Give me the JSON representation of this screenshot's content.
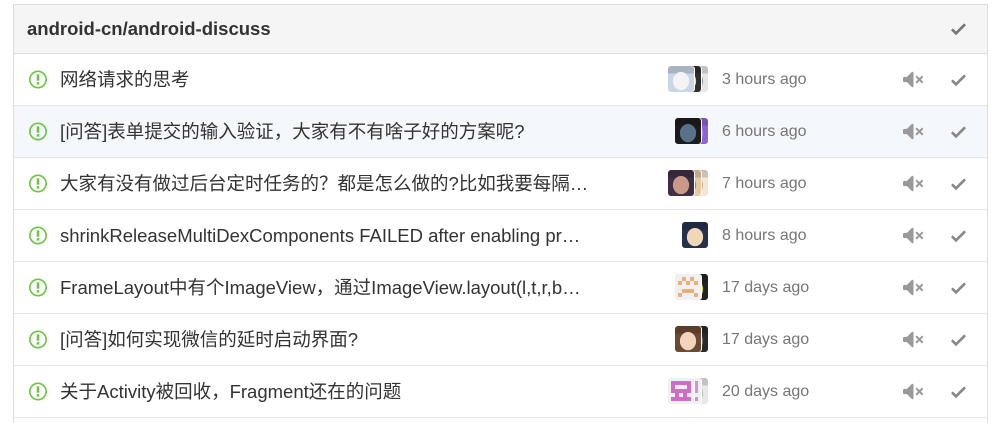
{
  "repo": {
    "name": "android-cn/android-discuss"
  },
  "icons": {
    "status": "issue-opened-icon",
    "mute": "mute-icon",
    "mark_read": "check-icon"
  },
  "colors": {
    "issue_open": "#6cc644",
    "icon": "#999999",
    "check": "#888888",
    "time_text": "#767676",
    "title_text": "#333333",
    "focus_bg": "#f4f7fb",
    "header_bg": "#f5f5f5"
  },
  "notifications": [
    {
      "title": "网络请求的思考",
      "time": "3 hours ago",
      "highlighted": false,
      "avatars": [
        {
          "avatar_icon": "photo",
          "bg": "#c8d6e6",
          "fg": "#f4f4f4"
        },
        {
          "avatar_icon": "photo",
          "bg": "#2e2e2e",
          "fg": "#d8d8d8"
        },
        {
          "avatar_icon": "photo",
          "bg": "#e6e6e6",
          "fg": "#9a9a9a"
        }
      ]
    },
    {
      "title": "[问答]表单提交的输入验证，大家有不有啥子好的方案呢?",
      "time": "6 hours ago",
      "highlighted": true,
      "avatars": [
        {
          "avatar_icon": "photo",
          "bg": "#1c1c1c",
          "fg": "#58708a"
        },
        {
          "avatar_icon": "photo",
          "bg": "#8f63d4",
          "fg": "#b38ae6"
        }
      ]
    },
    {
      "title": "大家有没有做过后台定时任务的？都是怎么做的?比如我要每隔…",
      "time": "7 hours ago",
      "highlighted": false,
      "avatars": [
        {
          "avatar_icon": "photo",
          "bg": "#3f2f45",
          "fg": "#c99a8a"
        },
        {
          "avatar_icon": "photo",
          "bg": "#e7c9a3",
          "fg": "#b0834f"
        },
        {
          "avatar_icon": "photo",
          "bg": "#f2e7d6",
          "fg": "#d5b88d"
        }
      ]
    },
    {
      "title": "shrinkReleaseMultiDexComponents FAILED after enabling pr…",
      "time": "8 hours ago",
      "highlighted": false,
      "avatars": [
        {
          "avatar_icon": "photo",
          "bg": "#25324d",
          "fg": "#f1d6b8"
        }
      ]
    },
    {
      "title": "FrameLayout中有个ImageView，通过ImageView.layout(l,t,r,b…",
      "time": "17 days ago",
      "highlighted": false,
      "avatars": [
        {
          "avatar_icon": "identicon",
          "bg": "#f0f0f0",
          "fg": "#eab07a"
        },
        {
          "avatar_icon": "photo",
          "bg": "#222222",
          "fg": "#d7d24a"
        }
      ]
    },
    {
      "title": "[问答]如何实现微信的延时启动界面?",
      "time": "17 days ago",
      "highlighted": false,
      "avatars": [
        {
          "avatar_icon": "photo",
          "bg": "#6b4a33",
          "fg": "#f2d4bd"
        },
        {
          "avatar_icon": "photo",
          "bg": "#2a2a2a",
          "fg": "#6b6b6b"
        }
      ]
    },
    {
      "title": "关于Activity被回收，Fragment还在的问题",
      "time": "20 days ago",
      "highlighted": false,
      "avatars": [
        {
          "avatar_icon": "identicon",
          "bg": "#f0f0f0",
          "fg": "#cf6dc4"
        },
        {
          "avatar_icon": "identicon",
          "bg": "#f0f0f0",
          "fg": "#d991cc"
        },
        {
          "avatar_icon": "photo",
          "bg": "#e8e8e8",
          "fg": "#b8b8b8"
        }
      ]
    }
  ]
}
